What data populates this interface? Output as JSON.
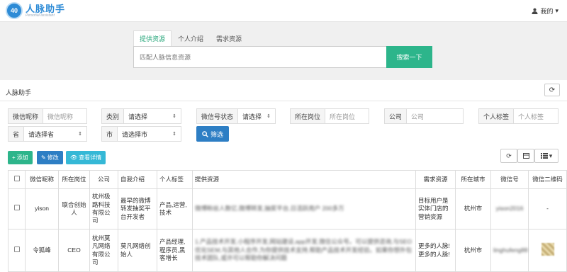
{
  "app": {
    "logo_badge": "40",
    "logo_title": "人脉助手",
    "logo_subtitle": "Personal assistant",
    "user_menu": "我的",
    "brand_color": "#2d8bd6"
  },
  "hero": {
    "tabs": [
      {
        "label": "提供资源",
        "active": true
      },
      {
        "label": "个人介绍",
        "active": false
      },
      {
        "label": "需求资源",
        "active": false
      }
    ],
    "search_placeholder": "匹配人脉信息资源",
    "search_button": "搜索一下",
    "accent_color": "#2db58b"
  },
  "section": {
    "title": "人脉助手"
  },
  "filters": {
    "nickname": {
      "label": "微信昵称",
      "placeholder": "微信昵称"
    },
    "category": {
      "label": "类别",
      "value": "请选择"
    },
    "wx_status": {
      "label": "微信号状态",
      "value": "请选择"
    },
    "position": {
      "label": "所在岗位",
      "placeholder": "所在岗位"
    },
    "company": {
      "label": "公司",
      "placeholder": "公司"
    },
    "tags": {
      "label": "个人标签",
      "placeholder": "个人标签"
    },
    "province": {
      "label": "省",
      "value": "请选择省"
    },
    "city": {
      "label": "市",
      "value": "请选择市"
    },
    "filter_button": "筛选"
  },
  "toolbar": {
    "add": "添加",
    "edit": "修改",
    "view": "查看详情"
  },
  "table": {
    "headers": [
      "微信昵称",
      "所在岗位",
      "公司",
      "自我介绍",
      "个人标签",
      "提供资源",
      "需求资源",
      "所在城市",
      "微信号",
      "微信二维码"
    ],
    "rows": [
      {
        "nickname": "yison",
        "position": "联合创始人",
        "company": "杭州极路科技有限公司",
        "intro": "最早的微博转发抽奖平台开发者",
        "tags": "产品,运营,技术",
        "resource": "微博粉丝人数亿,微博转发,抽奖平台,日活跃用户  200多万",
        "need": "目标用户是实体门店的营销资源",
        "city": "杭州市",
        "wechat": "yison2016",
        "qr": "-"
      },
      {
        "nickname": "令狐峰",
        "position": "CEO",
        "company": "杭州莫凡网络有限公司",
        "intro": "莫凡网络创始人",
        "tags": "产品经理,程序员,黑客增长",
        "resource": "1.产品技术开发,小程序开发,网站建设,app开发,微信公众号。可以提供咨询,与SEO优化SEM,与其他人合作,为你提供技术支持,帮助产品技术开发经验。如果你想外包技术团队,或许可以帮助你解决问题",
        "need": "更多的人脉!更多的人脉!",
        "city": "杭州市",
        "wechat": "linghufeng88",
        "qr": "qr"
      }
    ]
  }
}
